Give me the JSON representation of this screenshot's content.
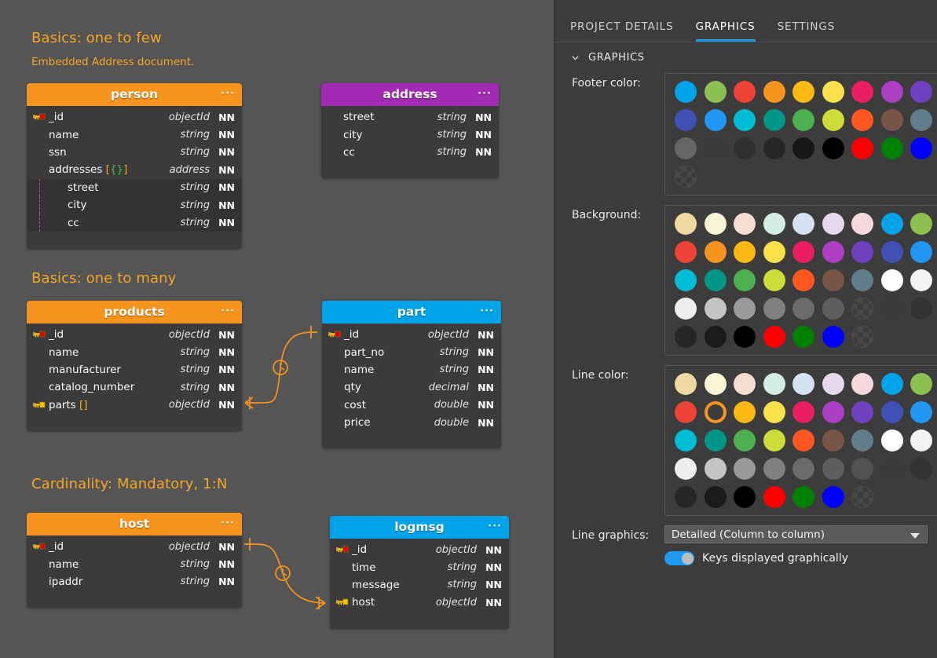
{
  "canvas": {
    "sections": [
      {
        "title": "Basics: one to few",
        "subtitle": "Embedded Address document."
      },
      {
        "title": "Basics: one to many",
        "subtitle": ""
      },
      {
        "title": "Cardinality: Mandatory, 1:N",
        "subtitle": ""
      }
    ],
    "menu_dots": "···",
    "tables": [
      {
        "name": "person",
        "header_color": "#f7941d",
        "rows": [
          {
            "key": "pk",
            "name": "_id",
            "type": "objectId",
            "nn": "NN",
            "indent": false,
            "json": ""
          },
          {
            "key": "none",
            "name": "name",
            "type": "string",
            "nn": "NN",
            "indent": false,
            "json": ""
          },
          {
            "key": "none",
            "name": "ssn",
            "type": "string",
            "nn": "NN",
            "indent": false,
            "json": ""
          },
          {
            "key": "none",
            "name": "addresses",
            "type": "address",
            "nn": "NN",
            "indent": false,
            "json": "[{}]"
          },
          {
            "key": "none",
            "name": "street",
            "type": "string",
            "nn": "NN",
            "indent": true,
            "json": ""
          },
          {
            "key": "none",
            "name": "city",
            "type": "string",
            "nn": "NN",
            "indent": true,
            "json": ""
          },
          {
            "key": "none",
            "name": "cc",
            "type": "string",
            "nn": "NN",
            "indent": true,
            "json": ""
          }
        ]
      },
      {
        "name": "address",
        "header_color": "#a32ab5",
        "rows": [
          {
            "key": "none",
            "name": "street",
            "type": "string",
            "nn": "NN",
            "indent": false,
            "json": ""
          },
          {
            "key": "none",
            "name": "city",
            "type": "string",
            "nn": "NN",
            "indent": false,
            "json": ""
          },
          {
            "key": "none",
            "name": "cc",
            "type": "string",
            "nn": "NN",
            "indent": false,
            "json": ""
          }
        ]
      },
      {
        "name": "products",
        "header_color": "#f7941d",
        "rows": [
          {
            "key": "pk",
            "name": "_id",
            "type": "objectId",
            "nn": "NN",
            "indent": false,
            "json": ""
          },
          {
            "key": "none",
            "name": "name",
            "type": "string",
            "nn": "NN",
            "indent": false,
            "json": ""
          },
          {
            "key": "none",
            "name": "manufacturer",
            "type": "string",
            "nn": "NN",
            "indent": false,
            "json": ""
          },
          {
            "key": "none",
            "name": "catalog_number",
            "type": "string",
            "nn": "NN",
            "indent": false,
            "json": ""
          },
          {
            "key": "fk",
            "name": "parts",
            "type": "objectId",
            "nn": "NN",
            "indent": false,
            "json": "[]"
          }
        ]
      },
      {
        "name": "part",
        "header_color": "#00a3e8",
        "rows": [
          {
            "key": "pk",
            "name": "_id",
            "type": "objectId",
            "nn": "NN",
            "indent": false,
            "json": ""
          },
          {
            "key": "none",
            "name": "part_no",
            "type": "string",
            "nn": "NN",
            "indent": false,
            "json": ""
          },
          {
            "key": "none",
            "name": "name",
            "type": "string",
            "nn": "NN",
            "indent": false,
            "json": ""
          },
          {
            "key": "none",
            "name": "qty",
            "type": "decimal",
            "nn": "NN",
            "indent": false,
            "json": ""
          },
          {
            "key": "none",
            "name": "cost",
            "type": "double",
            "nn": "NN",
            "indent": false,
            "json": ""
          },
          {
            "key": "none",
            "name": "price",
            "type": "double",
            "nn": "NN",
            "indent": false,
            "json": ""
          }
        ]
      },
      {
        "name": "host",
        "header_color": "#f7941d",
        "rows": [
          {
            "key": "pk",
            "name": "_id",
            "type": "objectId",
            "nn": "NN",
            "indent": false,
            "json": ""
          },
          {
            "key": "none",
            "name": "name",
            "type": "string",
            "nn": "NN",
            "indent": false,
            "json": ""
          },
          {
            "key": "none",
            "name": "ipaddr",
            "type": "string",
            "nn": "NN",
            "indent": false,
            "json": ""
          }
        ]
      },
      {
        "name": "logmsg",
        "header_color": "#00a3e8",
        "rows": [
          {
            "key": "pk",
            "name": "_id",
            "type": "objectId",
            "nn": "NN",
            "indent": false,
            "json": ""
          },
          {
            "key": "none",
            "name": "time",
            "type": "string",
            "nn": "NN",
            "indent": false,
            "json": ""
          },
          {
            "key": "none",
            "name": "message",
            "type": "string",
            "nn": "NN",
            "indent": false,
            "json": ""
          },
          {
            "key": "fk",
            "name": "host",
            "type": "objectId",
            "nn": "NN",
            "indent": false,
            "json": ""
          }
        ]
      }
    ],
    "relationship_color": "#f7941d"
  },
  "panel": {
    "tabs": [
      {
        "label": "PROJECT DETAILS",
        "active": false
      },
      {
        "label": "GRAPHICS",
        "active": true
      },
      {
        "label": "SETTINGS",
        "active": false
      }
    ],
    "section_header": "GRAPHICS",
    "fields": {
      "footer_color": {
        "label": "Footer color:",
        "rows": [
          [
            "#00a3e8",
            "#8cc051",
            "#ed4337",
            "#f7941d",
            "#fcb913",
            "#fae04c",
            "#e91e63",
            "#ac3fc4",
            "#7040c0"
          ],
          [
            "#3f51b5",
            "#2196f3",
            "#00bcd4",
            "#009688",
            "#4caf50",
            "#cddc39",
            "#ff5722",
            "#795548",
            "#607d8b"
          ],
          [
            "#666666",
            "#3a3a3a",
            "#303030",
            "#262626",
            "#171717",
            "#000000",
            "#ff0000",
            "#008000",
            "#0000ff"
          ],
          [
            "transparent"
          ]
        ]
      },
      "background": {
        "label": "Background:",
        "rows": [
          [
            "#f0d9a0",
            "#faf4d6",
            "#f5ddd2",
            "#d3ede3",
            "#d4e2f2",
            "#e6d9ee",
            "#f7d8dc",
            "#00a3e8",
            "#8cc051"
          ],
          [
            "#ed4337",
            "#f7941d",
            "#fcb913",
            "#fae04c",
            "#e91e63",
            "#ac3fc4",
            "#7040c0",
            "#3f51b5",
            "#2196f3"
          ],
          [
            "#00bcd4",
            "#009688",
            "#4caf50",
            "#cddc39",
            "#ff5722",
            "#795548",
            "#607d8b",
            "#ffffff",
            "#f2f2f2"
          ],
          [
            "#eeeeee",
            "#c4c4c4",
            "#9a9a9a",
            "#808080",
            "#6b6b6b",
            "#5e5e5e",
            "transparent",
            "#3a3a3a",
            "#333333"
          ],
          [
            "#262626",
            "#1b1b1b",
            "#000000",
            "#ff0000",
            "#008000",
            "#0000ff",
            "transparent"
          ]
        ],
        "hovered_swatch": "transparent",
        "tooltip": "transparent"
      },
      "line_color": {
        "label": "Line color:",
        "selected": "#f7941d",
        "rows": [
          [
            "#f0d9a0",
            "#faf4d6",
            "#f5ddd2",
            "#d3ede3",
            "#d4e2f2",
            "#e6d9ee",
            "#f7d8dc",
            "#00a3e8",
            "#8cc051"
          ],
          [
            "#ed4337",
            "#f7941d",
            "#fcb913",
            "#fae04c",
            "#e91e63",
            "#ac3fc4",
            "#7040c0",
            "#3f51b5",
            "#2196f3"
          ],
          [
            "#00bcd4",
            "#009688",
            "#4caf50",
            "#cddc39",
            "#ff5722",
            "#795548",
            "#607d8b",
            "#ffffff",
            "#f2f2f2"
          ],
          [
            "#eeeeee",
            "#c4c4c4",
            "#9a9a9a",
            "#808080",
            "#6b6b6b",
            "#5e5e5e",
            "#525252",
            "#3a3a3a",
            "#333333"
          ],
          [
            "#262626",
            "#1b1b1b",
            "#000000",
            "#ff0000",
            "#008000",
            "#0000ff",
            "transparent"
          ]
        ]
      },
      "line_graphics": {
        "label": "Line graphics:",
        "value": "Detailed (Column to column)",
        "options": [
          "Detailed (Column to column)"
        ]
      },
      "keys_toggle": {
        "label": "Keys displayed graphically",
        "on": true
      }
    }
  },
  "icons": {
    "chevron_down": "chevron-down-icon",
    "caret_down": "caret-down-icon",
    "key_primary": "key-primary-icon",
    "key_foreign": "key-foreign-icon",
    "hand_cursor": "hand-cursor-icon"
  }
}
